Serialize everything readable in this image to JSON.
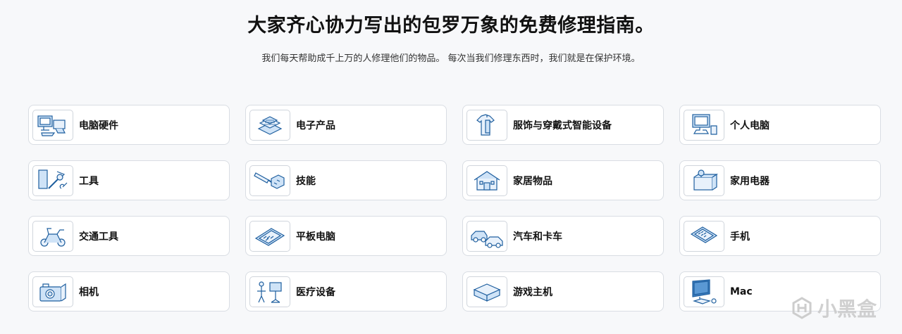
{
  "header": {
    "title": "大家齐心协力写出的包罗万象的免费修理指南。",
    "subtitle": "我们每天帮助成千上万的人修理他们的物品。 每次当我们修理东西时，我们就是在保护环境。"
  },
  "categories": [
    {
      "label": "电脑硬件",
      "icon": "computer-hardware-icon"
    },
    {
      "label": "电子产品",
      "icon": "electronics-icon"
    },
    {
      "label": "服饰与穿戴式智能设备",
      "icon": "apparel-icon"
    },
    {
      "label": "个人电脑",
      "icon": "pc-icon"
    },
    {
      "label": "工具",
      "icon": "tools-icon"
    },
    {
      "label": "技能",
      "icon": "skills-icon"
    },
    {
      "label": "家居物品",
      "icon": "home-icon"
    },
    {
      "label": "家用电器",
      "icon": "appliance-icon"
    },
    {
      "label": "交通工具",
      "icon": "vehicle-icon"
    },
    {
      "label": "平板电脑",
      "icon": "tablet-icon"
    },
    {
      "label": "汽车和卡车",
      "icon": "car-truck-icon"
    },
    {
      "label": "手机",
      "icon": "phone-icon"
    },
    {
      "label": "相机",
      "icon": "camera-icon"
    },
    {
      "label": "医疗设备",
      "icon": "medical-icon"
    },
    {
      "label": "游戏主机",
      "icon": "game-console-icon"
    },
    {
      "label": "Mac",
      "icon": "mac-icon"
    }
  ],
  "watermark": {
    "text": "小黑盒",
    "icon": "xiaoheihe-logo-icon"
  },
  "colors": {
    "accent": "#1f6fbf",
    "light_blue": "#cfe3f7",
    "border": "#d9dde3"
  }
}
